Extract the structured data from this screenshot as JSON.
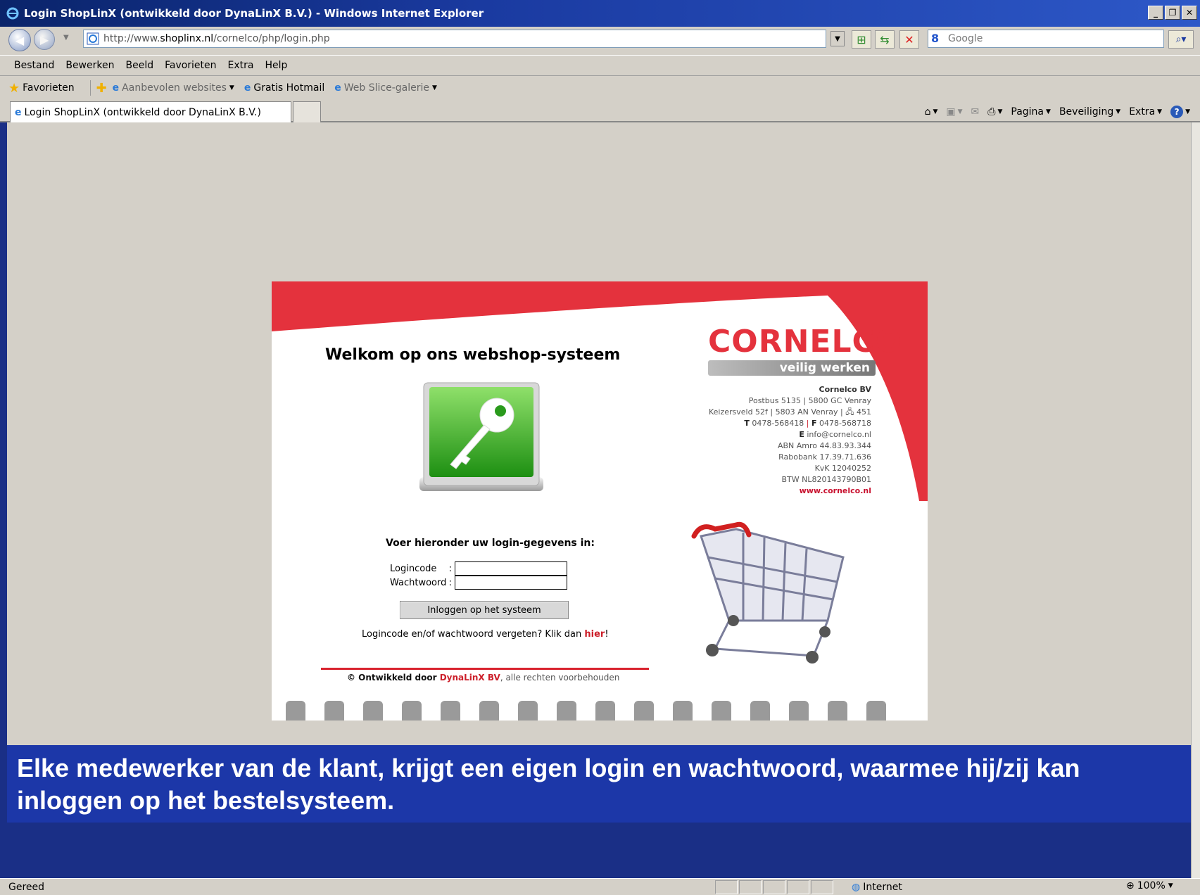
{
  "window": {
    "title": "Login ShopLinX (ontwikkeld door DynaLinX B.V.) - Windows Internet Explorer",
    "buttons": {
      "minimize": "_",
      "restore": "̸",
      "close": "X"
    }
  },
  "address_bar": {
    "url_prefix": "http://www.",
    "url_domain": "shoplinx.nl",
    "url_path": "/cornelco/php/login.php"
  },
  "search": {
    "placeholder": "Google"
  },
  "menu": [
    "Bestand",
    "Bewerken",
    "Beeld",
    "Favorieten",
    "Extra",
    "Help"
  ],
  "favorites_bar": {
    "favorites_label": "Favorieten",
    "items": [
      "Aanbevolen websites",
      "Gratis Hotmail",
      "Web Slice-galerie"
    ]
  },
  "tab": {
    "label": "Login ShopLinX (ontwikkeld door DynaLinX B.V.)"
  },
  "command_bar": {
    "page": "Pagina",
    "security": "Beveiliging",
    "extra": "Extra"
  },
  "login_page": {
    "welcome": "Welkom op ons webshop-systeem",
    "brand": "CORNELCO",
    "tagline": "veilig werken",
    "company": {
      "name": "Cornelco BV",
      "line1": "Postbus 5135 | 5800 GC Venray",
      "line2": "Keizersveld 52f | 5803 AN Venray | 🖧 451",
      "phone_label": "T",
      "phone": "0478-568418",
      "fax_label": "F",
      "fax": "0478-568718",
      "email_label": "E",
      "email": "info@cornelco.nl",
      "abn": "ABN Amro 44.83.93.344",
      "rabo": "Rabobank 17.39.71.636",
      "kvk": "KvK 12040252",
      "btw": "BTW NL820143790B01",
      "website": "www.cornelco.nl"
    },
    "form_heading": "Voer hieronder uw login-gegevens in:",
    "logincode_label": "Logincode",
    "password_label": "Wachtwoord",
    "colon": ":",
    "logincode_value": "",
    "password_value": "",
    "submit_label": "Inloggen op het systeem",
    "forgot_text": "Logincode en/of wachtwoord vergeten? Klik dan ",
    "forgot_link": "hier",
    "forgot_end": "!",
    "copyright_prefix": "© Ontwikkeld door ",
    "copyright_company": "DynaLinX BV",
    "copyright_suffix": ", alle rechten voorbehouden"
  },
  "caption": "Elke medewerker van de klant, krijgt een eigen login en wachtwoord, waarmee hij/zij kan inloggen op het bestelsysteem.",
  "status_bar": {
    "status": "Gereed",
    "zone": "Internet",
    "zoom": "100%"
  },
  "colors": {
    "brand_red": "#e4323d",
    "caption_blue": "#1c37a8",
    "chrome": "#d4d0c8"
  }
}
